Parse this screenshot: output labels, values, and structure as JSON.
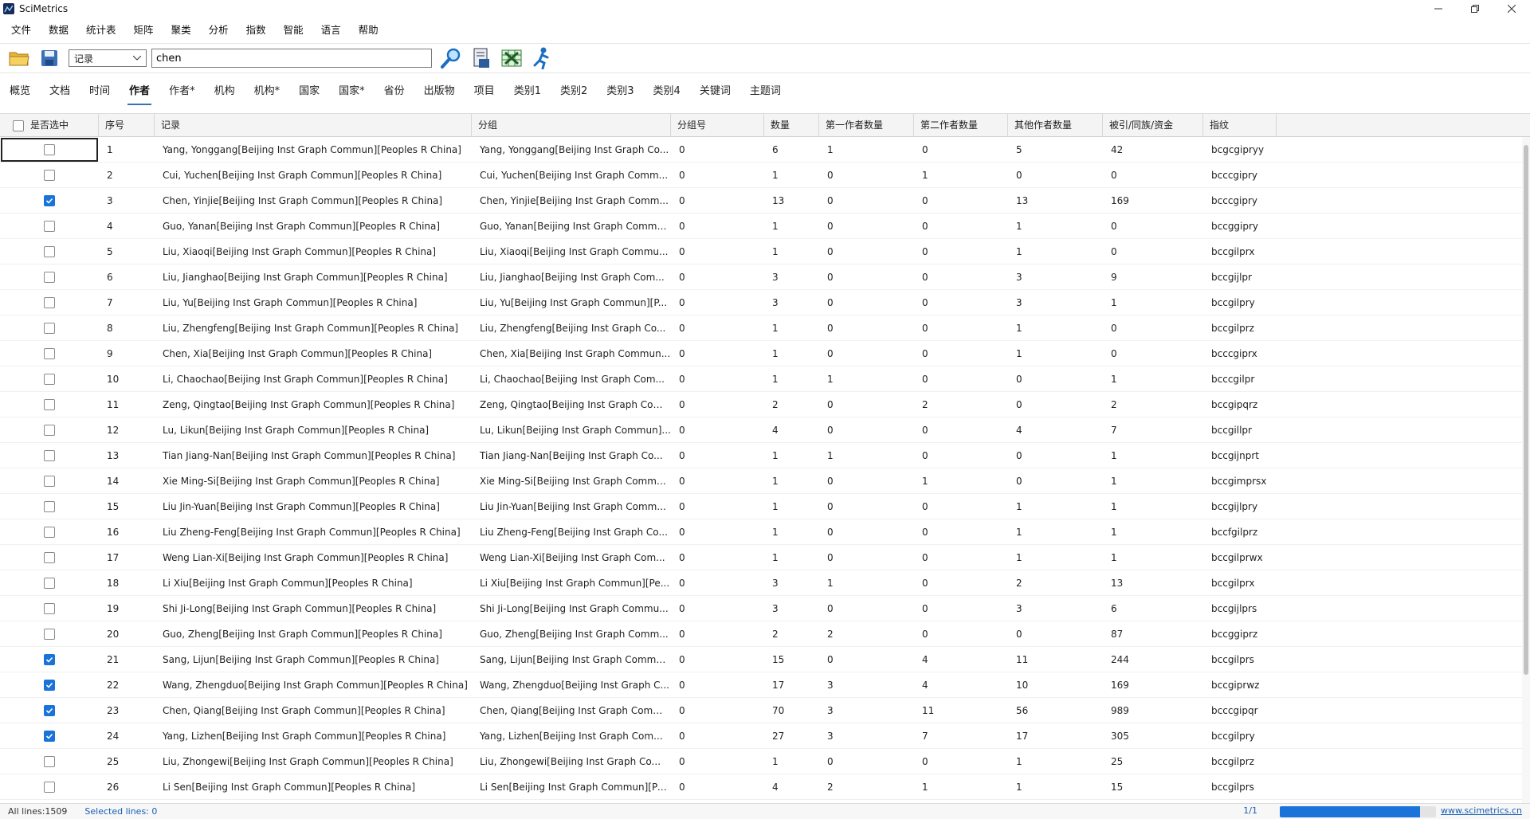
{
  "window": {
    "title": "SciMetrics"
  },
  "menu": [
    "文件",
    "数据",
    "统计表",
    "矩阵",
    "聚类",
    "分析",
    "指数",
    "智能",
    "语言",
    "帮助"
  ],
  "toolbar": {
    "select_value": "记录",
    "search_value": "chen"
  },
  "tabs": [
    "概览",
    "文档",
    "时间",
    "作者",
    "作者*",
    "机构",
    "机构*",
    "国家",
    "国家*",
    "省份",
    "出版物",
    "项目",
    "类别1",
    "类别2",
    "类别3",
    "类别4",
    "关键词",
    "主题词"
  ],
  "active_tab": "作者",
  "table": {
    "headers": [
      "是否选中",
      "序号",
      "记录",
      "分组",
      "分组号",
      "数量",
      "第一作者数量",
      "第二作者数量",
      "其他作者数量",
      "被引/同族/资金",
      "指纹"
    ],
    "rows": [
      {
        "checked": false,
        "seq": "1",
        "record": "Yang, Yonggang[Beijing Inst Graph Commun][Peoples R China]",
        "group": "Yang, Yonggang[Beijing Inst Graph Co...",
        "gno": "0",
        "count": "6",
        "first": "1",
        "second": "0",
        "other": "5",
        "cite": "42",
        "fp": "bcgcgipryy"
      },
      {
        "checked": false,
        "seq": "2",
        "record": "Cui, Yuchen[Beijing Inst Graph Commun][Peoples R China]",
        "group": "Cui, Yuchen[Beijing Inst Graph Comm...",
        "gno": "0",
        "count": "1",
        "first": "0",
        "second": "1",
        "other": "0",
        "cite": "0",
        "fp": "bcccgipry"
      },
      {
        "checked": true,
        "seq": "3",
        "record": "Chen, Yinjie[Beijing Inst Graph Commun][Peoples R China]",
        "group": "Chen, Yinjie[Beijing Inst Graph Comm...",
        "gno": "0",
        "count": "13",
        "first": "0",
        "second": "0",
        "other": "13",
        "cite": "169",
        "fp": "bcccgipry"
      },
      {
        "checked": false,
        "seq": "4",
        "record": "Guo, Yanan[Beijing Inst Graph Commun][Peoples R China]",
        "group": "Guo, Yanan[Beijing Inst Graph Commu...",
        "gno": "0",
        "count": "1",
        "first": "0",
        "second": "0",
        "other": "1",
        "cite": "0",
        "fp": "bccggipry"
      },
      {
        "checked": false,
        "seq": "5",
        "record": "Liu, Xiaoqi[Beijing Inst Graph Commun][Peoples R China]",
        "group": "Liu, Xiaoqi[Beijing Inst Graph Commu...",
        "gno": "0",
        "count": "1",
        "first": "0",
        "second": "0",
        "other": "1",
        "cite": "0",
        "fp": "bccgilprx"
      },
      {
        "checked": false,
        "seq": "6",
        "record": "Liu, Jianghao[Beijing Inst Graph Commun][Peoples R China]",
        "group": "Liu, Jianghao[Beijing Inst Graph Com...",
        "gno": "0",
        "count": "3",
        "first": "0",
        "second": "0",
        "other": "3",
        "cite": "9",
        "fp": "bccgijlpr"
      },
      {
        "checked": false,
        "seq": "7",
        "record": "Liu, Yu[Beijing Inst Graph Commun][Peoples R China]",
        "group": "Liu, Yu[Beijing Inst Graph Commun][P...",
        "gno": "0",
        "count": "3",
        "first": "0",
        "second": "0",
        "other": "3",
        "cite": "1",
        "fp": "bccgilpry"
      },
      {
        "checked": false,
        "seq": "8",
        "record": "Liu, Zhengfeng[Beijing Inst Graph Commun][Peoples R China]",
        "group": "Liu, Zhengfeng[Beijing Inst Graph Co...",
        "gno": "0",
        "count": "1",
        "first": "0",
        "second": "0",
        "other": "1",
        "cite": "0",
        "fp": "bccgilprz"
      },
      {
        "checked": false,
        "seq": "9",
        "record": "Chen, Xia[Beijing Inst Graph Commun][Peoples R China]",
        "group": "Chen, Xia[Beijing Inst Graph Commun...",
        "gno": "0",
        "count": "1",
        "first": "0",
        "second": "0",
        "other": "1",
        "cite": "0",
        "fp": "bcccgiprx"
      },
      {
        "checked": false,
        "seq": "10",
        "record": "Li, Chaochao[Beijing Inst Graph Commun][Peoples R China]",
        "group": "Li, Chaochao[Beijing Inst Graph Com...",
        "gno": "0",
        "count": "1",
        "first": "1",
        "second": "0",
        "other": "0",
        "cite": "1",
        "fp": "bcccgilpr"
      },
      {
        "checked": false,
        "seq": "11",
        "record": "Zeng, Qingtao[Beijing Inst Graph Commun][Peoples R China]",
        "group": "Zeng, Qingtao[Beijing Inst Graph Com...",
        "gno": "0",
        "count": "2",
        "first": "0",
        "second": "2",
        "other": "0",
        "cite": "2",
        "fp": "bccgipqrz"
      },
      {
        "checked": false,
        "seq": "12",
        "record": "Lu, Likun[Beijing Inst Graph Commun][Peoples R China]",
        "group": "Lu, Likun[Beijing Inst Graph Commun]...",
        "gno": "0",
        "count": "4",
        "first": "0",
        "second": "0",
        "other": "4",
        "cite": "7",
        "fp": "bccgillpr"
      },
      {
        "checked": false,
        "seq": "13",
        "record": "Tian Jiang-Nan[Beijing Inst Graph Commun][Peoples R China]",
        "group": "Tian Jiang-Nan[Beijing Inst Graph Co...",
        "gno": "0",
        "count": "1",
        "first": "1",
        "second": "0",
        "other": "0",
        "cite": "1",
        "fp": "bccgijnprt"
      },
      {
        "checked": false,
        "seq": "14",
        "record": "Xie Ming-Si[Beijing Inst Graph Commun][Peoples R China]",
        "group": "Xie Ming-Si[Beijing Inst Graph Commu...",
        "gno": "0",
        "count": "1",
        "first": "0",
        "second": "1",
        "other": "0",
        "cite": "1",
        "fp": "bccgimprsx"
      },
      {
        "checked": false,
        "seq": "15",
        "record": "Liu Jin-Yuan[Beijing Inst Graph Commun][Peoples R China]",
        "group": "Liu Jin-Yuan[Beijing Inst Graph Comm...",
        "gno": "0",
        "count": "1",
        "first": "0",
        "second": "0",
        "other": "1",
        "cite": "1",
        "fp": "bccgijlpry"
      },
      {
        "checked": false,
        "seq": "16",
        "record": "Liu Zheng-Feng[Beijing Inst Graph Commun][Peoples R China]",
        "group": "Liu Zheng-Feng[Beijing Inst Graph Co...",
        "gno": "0",
        "count": "1",
        "first": "0",
        "second": "0",
        "other": "1",
        "cite": "1",
        "fp": "bccfgilprz"
      },
      {
        "checked": false,
        "seq": "17",
        "record": "Weng Lian-Xi[Beijing Inst Graph Commun][Peoples R China]",
        "group": "Weng Lian-Xi[Beijing Inst Graph Com...",
        "gno": "0",
        "count": "1",
        "first": "0",
        "second": "0",
        "other": "1",
        "cite": "1",
        "fp": "bccgilprwx"
      },
      {
        "checked": false,
        "seq": "18",
        "record": "Li Xiu[Beijing Inst Graph Commun][Peoples R China]",
        "group": "Li Xiu[Beijing Inst Graph Commun][Pe...",
        "gno": "0",
        "count": "3",
        "first": "1",
        "second": "0",
        "other": "2",
        "cite": "13",
        "fp": "bccgilprx"
      },
      {
        "checked": false,
        "seq": "19",
        "record": "Shi Ji-Long[Beijing Inst Graph Commun][Peoples R China]",
        "group": "Shi Ji-Long[Beijing Inst Graph Commu...",
        "gno": "0",
        "count": "3",
        "first": "0",
        "second": "0",
        "other": "3",
        "cite": "6",
        "fp": "bccgijlprs"
      },
      {
        "checked": false,
        "seq": "20",
        "record": "Guo, Zheng[Beijing Inst Graph Commun][Peoples R China]",
        "group": "Guo, Zheng[Beijing Inst Graph Comm...",
        "gno": "0",
        "count": "2",
        "first": "2",
        "second": "0",
        "other": "0",
        "cite": "87",
        "fp": "bccggiprz"
      },
      {
        "checked": true,
        "seq": "21",
        "record": "Sang, Lijun[Beijing Inst Graph Commun][Peoples R China]",
        "group": "Sang, Lijun[Beijing Inst Graph Commu...",
        "gno": "0",
        "count": "15",
        "first": "0",
        "second": "4",
        "other": "11",
        "cite": "244",
        "fp": "bccgilprs"
      },
      {
        "checked": true,
        "seq": "22",
        "record": "Wang, Zhengduo[Beijing Inst Graph Commun][Peoples R China]",
        "group": "Wang, Zhengduo[Beijing Inst Graph C...",
        "gno": "0",
        "count": "17",
        "first": "3",
        "second": "4",
        "other": "10",
        "cite": "169",
        "fp": "bccgiprwz"
      },
      {
        "checked": true,
        "seq": "23",
        "record": "Chen, Qiang[Beijing Inst Graph Commun][Peoples R China]",
        "group": "Chen, Qiang[Beijing Inst Graph Comm...",
        "gno": "0",
        "count": "70",
        "first": "3",
        "second": "11",
        "other": "56",
        "cite": "989",
        "fp": "bcccgipqr"
      },
      {
        "checked": true,
        "seq": "24",
        "record": "Yang, Lizhen[Beijing Inst Graph Commun][Peoples R China]",
        "group": "Yang, Lizhen[Beijing Inst Graph Com...",
        "gno": "0",
        "count": "27",
        "first": "3",
        "second": "7",
        "other": "17",
        "cite": "305",
        "fp": "bccgilpry"
      },
      {
        "checked": false,
        "seq": "25",
        "record": "Liu, Zhongewi[Beijing Inst Graph Commun][Peoples R China]",
        "group": "Liu, Zhongewi[Beijing Inst Graph Co...",
        "gno": "0",
        "count": "1",
        "first": "0",
        "second": "0",
        "other": "1",
        "cite": "25",
        "fp": "bccgilprz"
      },
      {
        "checked": false,
        "seq": "26",
        "record": "Li Sen[Beijing Inst Graph Commun][Peoples R China]",
        "group": "Li Sen[Beijing Inst Graph Commun][Pe...",
        "gno": "0",
        "count": "4",
        "first": "2",
        "second": "1",
        "other": "1",
        "cite": "15",
        "fp": "bccgilprs"
      }
    ]
  },
  "status": {
    "all_lines": "All lines:1509",
    "selected_lines": "Selected lines: 0",
    "page": "1/1",
    "progress": 0.9,
    "link": "www.scimetrics.cn"
  },
  "colors": {
    "accent": "#1a73d9",
    "link": "#1a5fb4"
  }
}
